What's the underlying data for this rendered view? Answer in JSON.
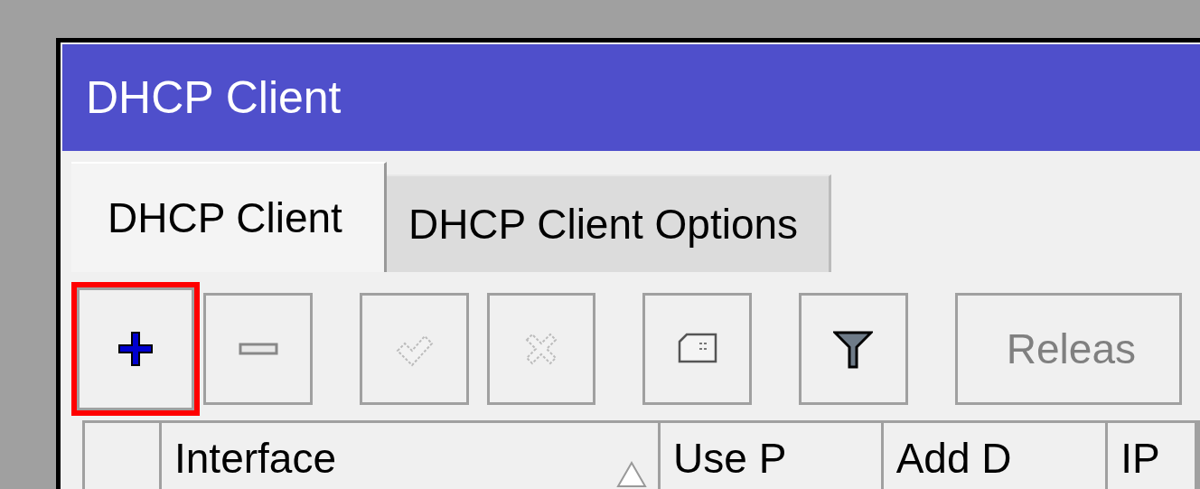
{
  "window": {
    "title": "DHCP Client"
  },
  "tabs": [
    {
      "label": "DHCP Client",
      "selected": true
    },
    {
      "label": "DHCP Client Options",
      "selected": false
    }
  ],
  "toolbar": [
    {
      "kind": "add",
      "disabled": false,
      "highlighted": true
    },
    {
      "kind": "remove",
      "disabled": false,
      "highlighted": false
    },
    {
      "kind": "enable",
      "disabled": true,
      "highlighted": false
    },
    {
      "kind": "disable",
      "disabled": true,
      "highlighted": false
    },
    {
      "kind": "comment",
      "disabled": false,
      "highlighted": false
    },
    {
      "kind": "filter",
      "disabled": false,
      "highlighted": false
    },
    {
      "kind": "text",
      "label": "Releas",
      "disabled": true,
      "highlighted": false
    }
  ],
  "table": {
    "columns": [
      {
        "sorted": false
      },
      {
        "label": "Interface",
        "sorted": true
      },
      {
        "label": "Use P",
        "sorted": false
      },
      {
        "label": "Add D",
        "sorted": false
      },
      {
        "label": "IP",
        "sorted": false
      }
    ]
  }
}
